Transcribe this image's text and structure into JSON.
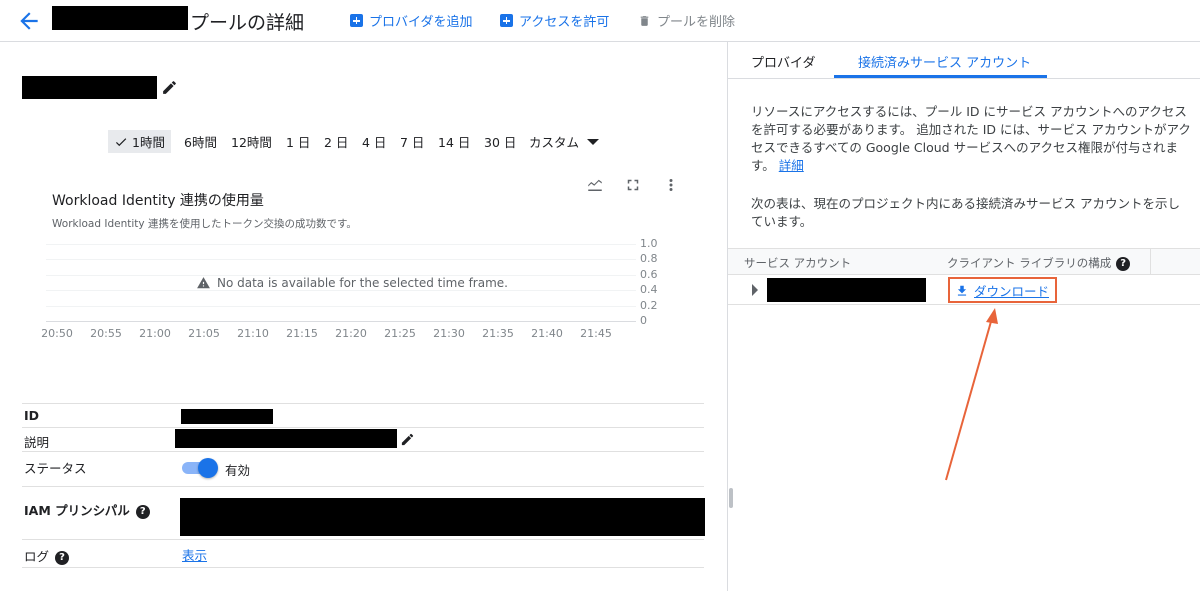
{
  "header": {
    "title_suffix": "プールの詳細",
    "add_provider_label": "プロバイダを追加",
    "grant_access_label": "アクセスを許可",
    "delete_pool_label": "プールを削除"
  },
  "time_ranges": {
    "r1h": "1時間",
    "r6h": "6時間",
    "r12h": "12時間",
    "r1d": "1 日",
    "r2d": "2 日",
    "r4d": "4 日",
    "r7d": "7 日",
    "r14d": "14 日",
    "r30d": "30 日",
    "custom": "カスタム"
  },
  "chart": {
    "title": "Workload Identity 連携の使用量",
    "subtitle": "Workload Identity 連携を使用したトークン交換の成功数です。",
    "no_data": "No data is available for the selected time frame.",
    "y_ticks": [
      "1.0",
      "0.8",
      "0.6",
      "0.4",
      "0.2",
      "0"
    ],
    "x_ticks": [
      "20:50",
      "20:55",
      "21:00",
      "21:05",
      "21:10",
      "21:15",
      "21:20",
      "21:25",
      "21:30",
      "21:35",
      "21:40",
      "21:45"
    ]
  },
  "chart_data": {
    "type": "line",
    "title": "Workload Identity 連携の使用量",
    "subtitle": "Workload Identity 連携を使用したトークン交換の成功数です。",
    "x": [
      "20:50",
      "20:55",
      "21:00",
      "21:05",
      "21:10",
      "21:15",
      "21:20",
      "21:25",
      "21:30",
      "21:35",
      "21:40",
      "21:45"
    ],
    "series": [],
    "ylim": [
      0,
      1.0
    ],
    "grid": true,
    "annotation": "No data is available for the selected time frame."
  },
  "details": {
    "id_label": "ID",
    "description_label": "説明",
    "status_label": "ステータス",
    "status_value": "有効",
    "iam_label": "IAM プリンシパル",
    "log_label": "ログ",
    "log_link": "表示",
    "help_glyph": "?"
  },
  "right": {
    "tab_providers": "プロバイダ",
    "tab_connected": "接続済みサービス アカウント",
    "paragraph1": "リソースにアクセスするには、プール ID にサービス アカウントへのアクセスを許可する必要があります。 追加された ID には、サービス アカウントがアクセスできるすべての Google Cloud サービスへのアクセス権限が付与されます。",
    "details_link": "詳細",
    "paragraph2": "次の表は、現在のプロジェクト内にある接続済みサービス アカウントを示しています。",
    "col_service_account": "サービス アカウント",
    "col_client_library": "クライアント ライブラリの構成",
    "download_label": "ダウンロード"
  },
  "colors": {
    "accent": "#1a73e8",
    "highlight_box": "#e8643a",
    "arrow": "#e8643a"
  }
}
